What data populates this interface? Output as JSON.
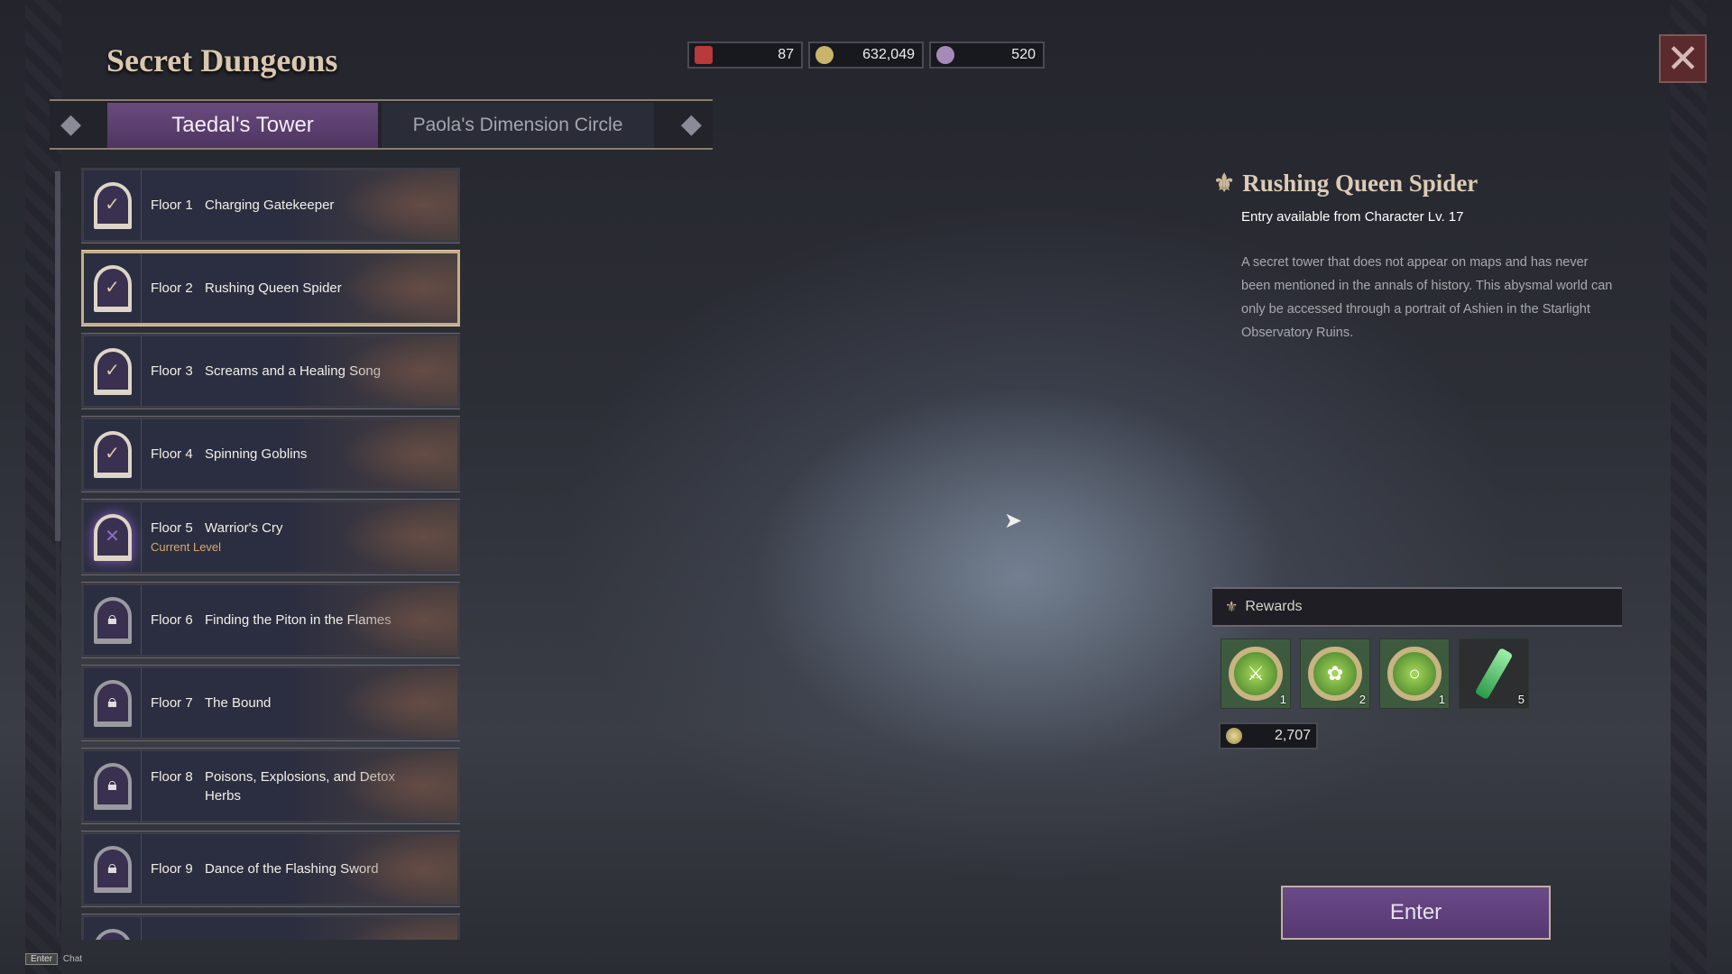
{
  "header": {
    "title": "Secret Dungeons"
  },
  "tabs": [
    {
      "label": "Taedal's Tower",
      "active": true
    },
    {
      "label": "Paola's Dimension Circle",
      "active": false
    }
  ],
  "currencies": [
    {
      "icon": "ticket-icon",
      "value": "87",
      "color": "#b83a3a"
    },
    {
      "icon": "gold-coin-icon",
      "value": "632,049",
      "color": "#c8b46a"
    },
    {
      "icon": "hooded-figure-icon",
      "value": "520",
      "color": "#a88ab8"
    }
  ],
  "floors": [
    {
      "floor": "Floor 1",
      "name": "Charging Gatekeeper",
      "state": "cleared"
    },
    {
      "floor": "Floor 2",
      "name": "Rushing Queen Spider",
      "state": "cleared",
      "selected": true
    },
    {
      "floor": "Floor 3",
      "name": "Screams and a Healing Song",
      "state": "cleared"
    },
    {
      "floor": "Floor 4",
      "name": "Spinning Goblins",
      "state": "cleared"
    },
    {
      "floor": "Floor 5",
      "name": "Warrior's Cry",
      "state": "current",
      "status": "Current Level"
    },
    {
      "floor": "Floor 6",
      "name": "Finding the Piton in the Flames",
      "state": "locked"
    },
    {
      "floor": "Floor 7",
      "name": "The Bound",
      "state": "locked"
    },
    {
      "floor": "Floor 8",
      "name": "Poisons, Explosions, and Detox Herbs",
      "state": "locked"
    },
    {
      "floor": "Floor 9",
      "name": "Dance of the Flashing Sword",
      "state": "locked"
    }
  ],
  "detail": {
    "title": "Rushing Queen Spider",
    "entry": "Entry available from Character Lv. 17",
    "description": "A secret tower that does not appear on maps and has never been mentioned in the annals of history. This abysmal world can only be accessed through a portrait of Ashien in the Starlight Observatory Ruins.",
    "rewards_label": "Rewards",
    "rewards": [
      {
        "icon": "crossed-swords-medal-icon",
        "qty": "1"
      },
      {
        "icon": "flower-medal-icon",
        "qty": "2"
      },
      {
        "icon": "ring-medal-icon",
        "qty": "1"
      },
      {
        "icon": "green-vial-icon",
        "qty": "5"
      }
    ],
    "gold": "2,707",
    "enter_label": "Enter"
  },
  "chat": {
    "key": "Enter",
    "label": "Chat"
  },
  "colors": {
    "accent": "#5e4078",
    "gold": "#d9c7ae",
    "current": "#d8a86a"
  }
}
